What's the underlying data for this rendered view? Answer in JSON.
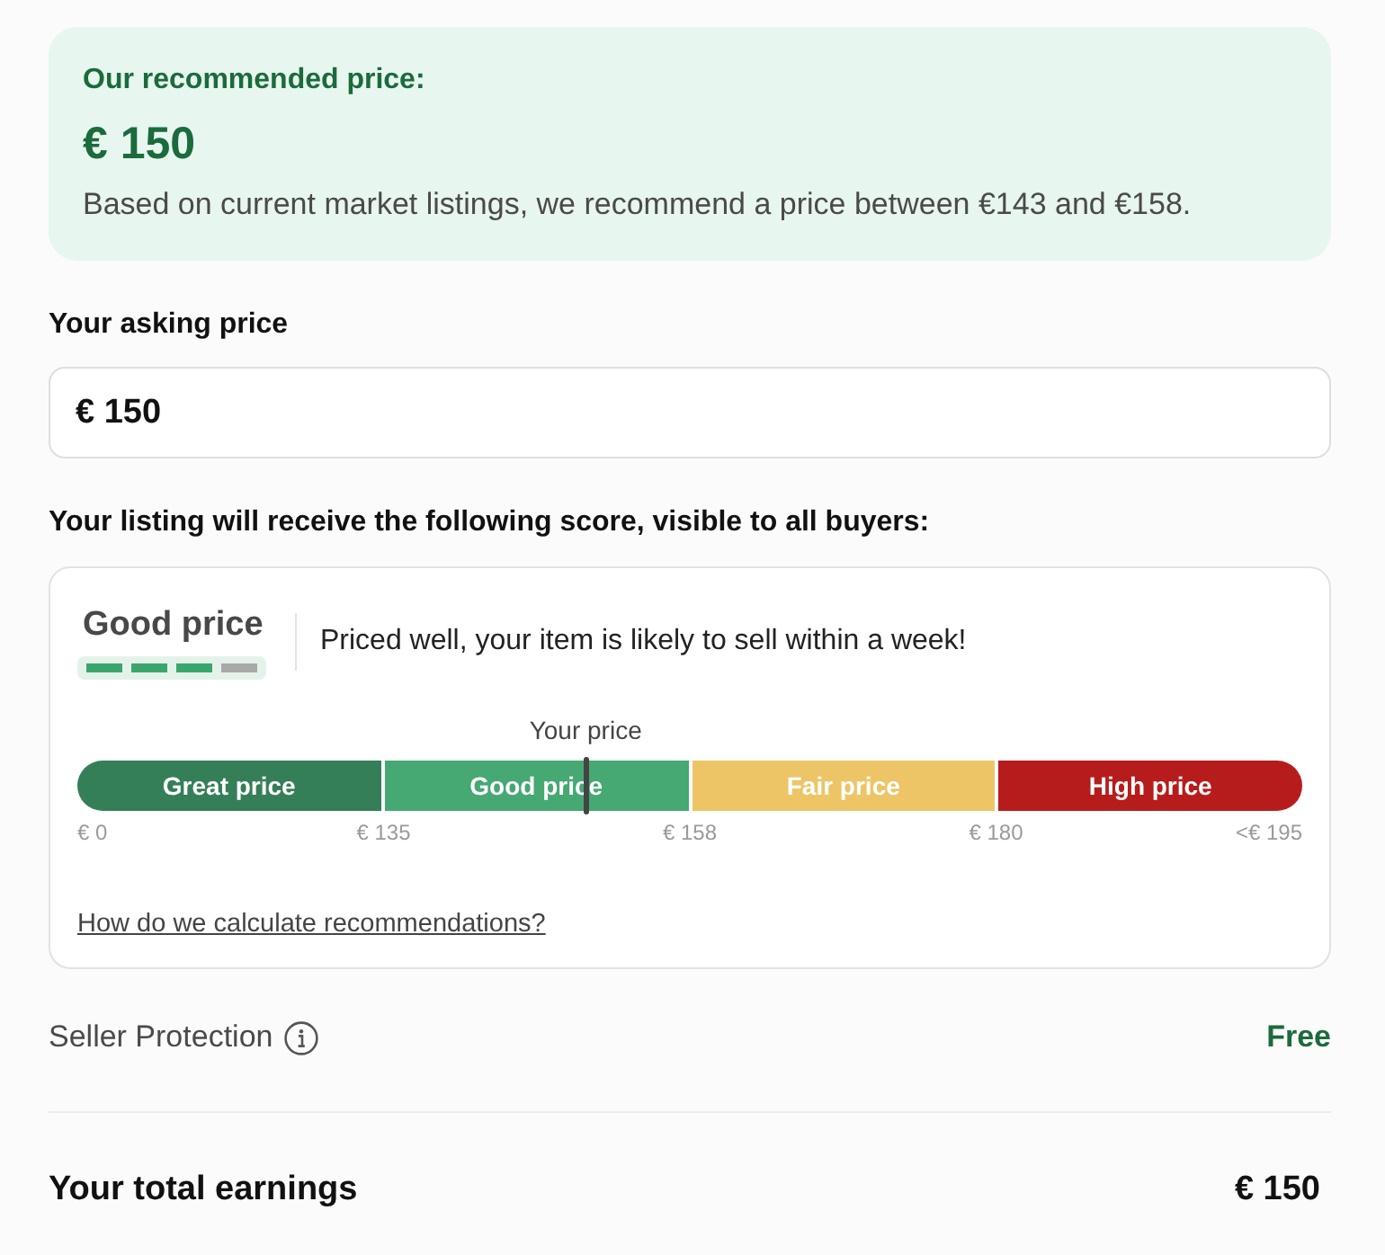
{
  "recommendation": {
    "title": "Our recommended price:",
    "price": "€ 150",
    "description": "Based on current market listings, we recommend a price between €143 and €158."
  },
  "asking_price": {
    "label": "Your asking price",
    "value": "€ 150"
  },
  "score": {
    "heading": "Your listing will receive the following score, visible to all buyers:",
    "rating": {
      "label": "Good price",
      "level": 0.75
    },
    "message": "Priced well, your item is likely to sell within a week!",
    "marker_label": "Your price",
    "level": 0.415,
    "segments": [
      {
        "label": "Great price",
        "color": "#357f58"
      },
      {
        "label": "Good price",
        "color": "#46a873"
      },
      {
        "label": "Fair price",
        "color": "#edc566"
      },
      {
        "label": "High price",
        "color": "#b71c1c"
      }
    ],
    "ticks": [
      "€ 0",
      "€ 135",
      "€ 158",
      "€ 180",
      "<€ 195"
    ],
    "link": "How do we calculate recommendations?"
  },
  "seller_protection": {
    "label": "Seller Protection",
    "value": "Free"
  },
  "total": {
    "label": "Your total earnings",
    "value": "€ 150"
  }
}
